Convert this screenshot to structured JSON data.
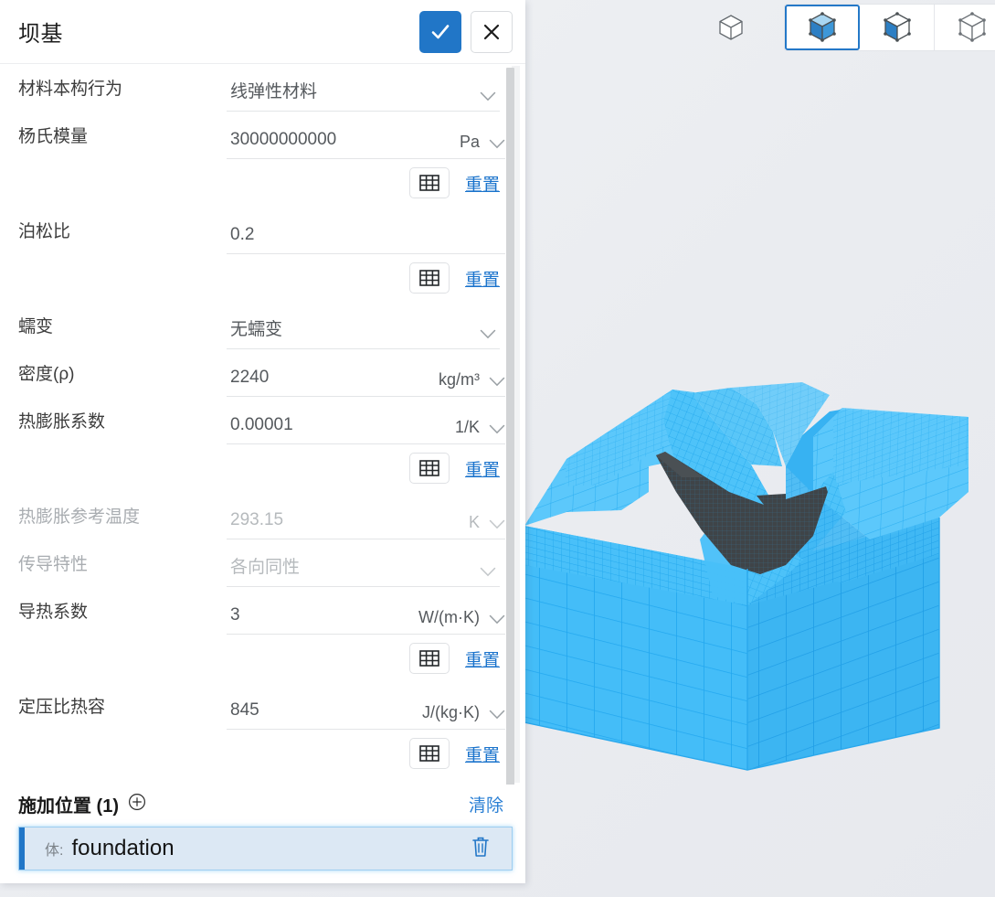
{
  "panel": {
    "title": "坝基",
    "confirm_icon": "check-icon",
    "cancel_icon": "close-icon",
    "rows": [
      {
        "kind": "select",
        "label": "材料本构行为",
        "value": "线弹性材料",
        "dim": false
      },
      {
        "kind": "value",
        "label": "杨氏模量",
        "value": "30000000000",
        "unit": "Pa",
        "dim": false,
        "field_w": 210,
        "unit_w": 95
      },
      {
        "kind": "reset",
        "table_icon": "table-icon",
        "reset_label": "重置"
      },
      {
        "kind": "value",
        "label": "泊松比",
        "value": "0.2",
        "unit": "",
        "dim": false,
        "field_w": 305,
        "unit_w": 0
      },
      {
        "kind": "reset",
        "table_icon": "table-icon",
        "reset_label": "重置"
      },
      {
        "kind": "select",
        "label": "蠕变",
        "value": "无蠕变",
        "dim": false
      },
      {
        "kind": "value",
        "label": "密度(ρ)",
        "value": "2240",
        "unit": "kg/m³",
        "dim": false,
        "field_w": 190,
        "unit_w": 115
      },
      {
        "kind": "value",
        "label": "热膨胀系数",
        "value": "0.00001",
        "unit": "1/K",
        "dim": false,
        "field_w": 215,
        "unit_w": 90
      },
      {
        "kind": "reset",
        "table_icon": "table-icon",
        "reset_label": "重置"
      },
      {
        "kind": "value",
        "label": "热膨胀参考温度",
        "value": "293.15",
        "unit": "K",
        "dim": true,
        "field_w": 232,
        "unit_w": 73
      },
      {
        "kind": "select",
        "label": "传导特性",
        "value": "各向同性",
        "dim": true
      },
      {
        "kind": "value",
        "label": "导热系数",
        "value": "3",
        "unit": "W/(m·K)",
        "dim": false,
        "field_w": 175,
        "unit_w": 130
      },
      {
        "kind": "reset",
        "table_icon": "table-icon",
        "reset_label": "重置"
      },
      {
        "kind": "value",
        "label": "定压比热容",
        "value": "845",
        "unit": "J/(kg·K)",
        "dim": false,
        "field_w": 178,
        "unit_w": 127
      },
      {
        "kind": "reset",
        "table_icon": "table-icon",
        "reset_label": "重置"
      }
    ],
    "location": {
      "title": "施加位置 (1)",
      "add_icon": "plus-circle-icon",
      "clear_label": "清除",
      "items": [
        {
          "kind_label": "体:",
          "name": "foundation",
          "delete_icon": "trash-icon"
        }
      ]
    }
  },
  "viewcube_toolbar": {
    "buttons": [
      {
        "name": "view-wireframe-cube",
        "icon": "cube-outline-icon",
        "active": false,
        "grouped": false
      },
      {
        "name": "view-shaded-cube",
        "icon": "cube-filled-icon",
        "active": true,
        "grouped": true
      },
      {
        "name": "view-half-shaded-cube",
        "icon": "cube-half-icon",
        "active": false,
        "grouped": true
      },
      {
        "name": "view-edges-cube",
        "icon": "cube-edges-icon",
        "active": false,
        "grouped": true
      }
    ]
  },
  "viewport": {
    "background_color": "#edeff2",
    "mesh_color": "#44bdf8",
    "mesh_line_color": "#2aa8ec",
    "dam_color": "#3f4448"
  }
}
